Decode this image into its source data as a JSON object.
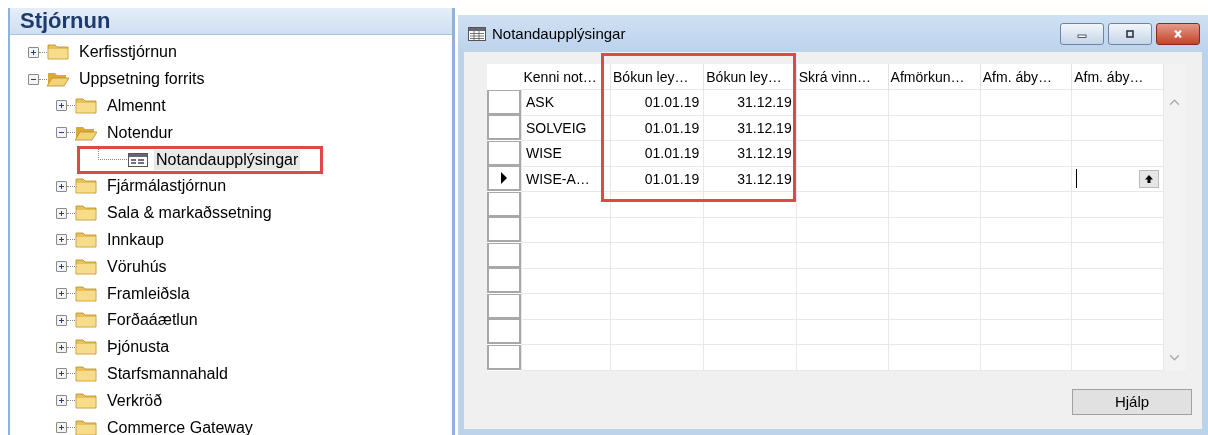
{
  "navigation": {
    "title": "Stjórnun",
    "tree": [
      {
        "label": "Kerfisstjórnun",
        "kind": "folder",
        "expanded": false
      },
      {
        "label": "Uppsetning forrits",
        "kind": "folder",
        "expanded": true,
        "children": [
          {
            "label": "Almennt",
            "kind": "folder",
            "expanded": false
          },
          {
            "label": "Notendur",
            "kind": "folder",
            "expanded": true,
            "children": [
              {
                "label": "Notandaupplýsingar",
                "kind": "form",
                "selected": true,
                "highlighted": true
              }
            ]
          },
          {
            "label": "Fjármálastjórnun",
            "kind": "folder",
            "expanded": false
          },
          {
            "label": "Sala & markaðssetning",
            "kind": "folder",
            "expanded": false
          },
          {
            "label": "Innkaup",
            "kind": "folder",
            "expanded": false
          },
          {
            "label": "Vöruhús",
            "kind": "folder",
            "expanded": false
          },
          {
            "label": "Framleiðsla",
            "kind": "folder",
            "expanded": false
          },
          {
            "label": "Forðaáætlun",
            "kind": "folder",
            "expanded": false
          },
          {
            "label": "Þjónusta",
            "kind": "folder",
            "expanded": false
          },
          {
            "label": "Starfsmannahald",
            "kind": "folder",
            "expanded": false
          },
          {
            "label": "Verkröð",
            "kind": "folder",
            "expanded": false
          },
          {
            "label": "Commerce Gateway",
            "kind": "folder",
            "expanded": false
          }
        ]
      }
    ]
  },
  "window": {
    "title": "Notandaupplýsingar",
    "table": {
      "columns": [
        {
          "label": "Kenni not…",
          "kind": "text",
          "highlighted": false
        },
        {
          "label": "Bókun ley…",
          "kind": "date",
          "highlighted": true
        },
        {
          "label": "Bókun ley…",
          "kind": "date",
          "highlighted": true
        },
        {
          "label": "Skrá vinn…",
          "kind": "text",
          "highlighted": false
        },
        {
          "label": "Afmörkun…",
          "kind": "text",
          "highlighted": false
        },
        {
          "label": "Afm. áby…",
          "kind": "text",
          "highlighted": false
        },
        {
          "label": "Afm. áby…",
          "kind": "text",
          "highlighted": false
        }
      ],
      "rows": [
        {
          "current": false,
          "editing": false,
          "cells": [
            "ASK",
            "01.01.19",
            "31.12.19"
          ]
        },
        {
          "current": false,
          "editing": false,
          "cells": [
            "SOLVEIG",
            "01.01.19",
            "31.12.19"
          ]
        },
        {
          "current": false,
          "editing": false,
          "cells": [
            "WISE",
            "01.01.19",
            "31.12.19"
          ]
        },
        {
          "current": true,
          "editing": true,
          "cells": [
            "WISE-A…",
            "01.01.19",
            "31.12.19"
          ]
        }
      ]
    },
    "buttons": [
      "Hjálp"
    ]
  }
}
